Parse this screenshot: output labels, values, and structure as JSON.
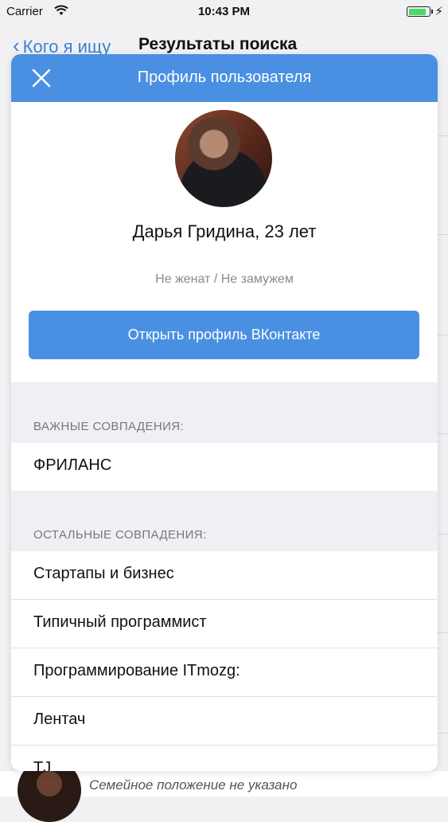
{
  "status_bar": {
    "carrier": "Carrier",
    "time": "10:43 PM",
    "battery_level": 0.9
  },
  "background_nav": {
    "back_label": "Кого я ищу",
    "title": "Результаты поиска"
  },
  "background_row": {
    "text": "Семейное положение не указано"
  },
  "sheet": {
    "title": "Профиль пользователя",
    "name": "Дарья Гридина, 23 лет",
    "marital_status": "Не женат / Не замужем",
    "open_button": "Открыть профиль ВКонтакте",
    "important_header": "ВАЖНЫЕ СОВПАДЕНИЯ:",
    "important_items": [
      "ФРИЛАНС"
    ],
    "other_header": "ОСТАЛЬНЫЕ СОВПАДЕНИЯ:",
    "other_items": [
      "Стартапы и бизнес",
      "Типичный программист",
      "Программирование ITmozg:",
      "Лентач",
      "TJ"
    ]
  },
  "colors": {
    "accent": "#4a90e2",
    "battery": "#4cd964"
  }
}
